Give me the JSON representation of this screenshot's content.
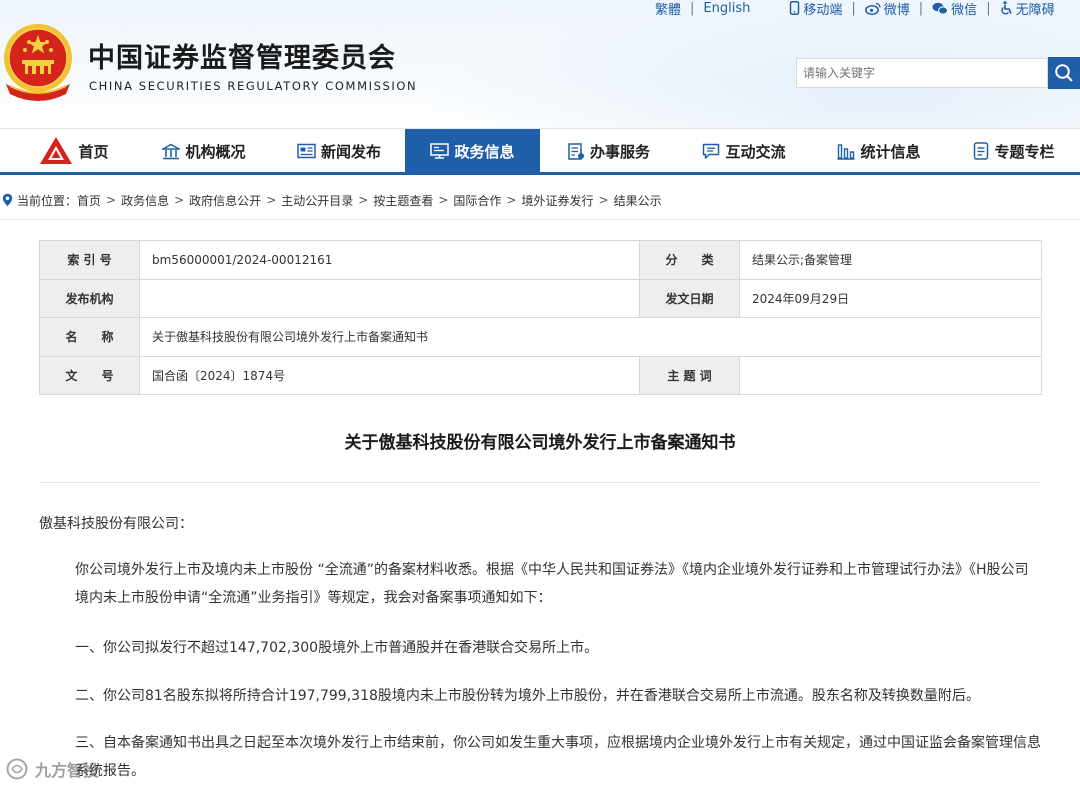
{
  "colors": {
    "brand_blue": "#1f5ea8",
    "emblem_red": "#d4241c",
    "emblem_gold": "#f2c230"
  },
  "top_links": {
    "traditional": "繁體",
    "english": "English",
    "mobile": "移动端",
    "weibo": "微博",
    "wechat": "微信",
    "accessibility": "无障碍"
  },
  "header": {
    "name_cn": "中国证券监督管理委员会",
    "name_en": "CHINA SECURITIES REGULATORY COMMISSION",
    "emblem_icon": "national-emblem-icon"
  },
  "search": {
    "placeholder": "请输入关键字",
    "icon": "search-icon"
  },
  "nav": {
    "items": [
      {
        "label": "首页",
        "icon": "csrc-logo-icon",
        "active": false
      },
      {
        "label": "机构概况",
        "icon": "building-icon",
        "active": false
      },
      {
        "label": "新闻发布",
        "icon": "newspaper-icon",
        "active": false
      },
      {
        "label": "政务信息",
        "icon": "monitor-icon",
        "active": true
      },
      {
        "label": "办事服务",
        "icon": "checklist-icon",
        "active": false
      },
      {
        "label": "互动交流",
        "icon": "chat-icon",
        "active": false
      },
      {
        "label": "统计信息",
        "icon": "bar-chart-icon",
        "active": false
      },
      {
        "label": "专题专栏",
        "icon": "document-icon",
        "active": false
      }
    ]
  },
  "breadcrumb": {
    "prefix": "当前位置：",
    "items": [
      "首页",
      "政务信息",
      "政府信息公开",
      "主动公开目录",
      "按主题查看",
      "国际合作",
      "境外证券发行",
      "结果公示"
    ]
  },
  "info": {
    "index_label": "索 引 号",
    "index_value": "bm56000001/2024-00012161",
    "category_label": "分　　类",
    "category_value": "结果公示;备案管理",
    "publisher_label": "发布机构",
    "publisher_value": "",
    "date_label": "发文日期",
    "date_value": "2024年09月29日",
    "name_label": "名　　称",
    "name_value": "关于傲基科技股份有限公司境外发行上市备案通知书",
    "docno_label": "文　　号",
    "docno_value": "国合函〔2024〕1874号",
    "keywords_label": "主 题 词",
    "keywords_value": ""
  },
  "article": {
    "title": "关于傲基科技股份有限公司境外发行上市备案通知书",
    "salutation": "傲基科技股份有限公司：",
    "para1": "你公司境外发行上市及境内未上市股份 “全流通”的备案材料收悉。根据《中华人民共和国证券法》《境内企业境外发行证券和上市管理试行办法》《H股公司境内未上市股份申请“全流通”业务指引》等规定，我会对备案事项通知如下：",
    "item1": "一、你公司拟发行不超过147,702,300股境外上市普通股并在香港联合交易所上市。",
    "item2": "二、你公司81名股东拟将所持合计197,799,318股境内未上市股份转为境外上市股份，并在香港联合交易所上市流通。股东名称及转换数量附后。",
    "item3": "三、自本备案通知书出具之日起至本次境外发行上市结束前，你公司如发生重大事项，应根据境内企业境外发行上市有关规定，通过中国证监会备案管理信息系统报告。"
  },
  "watermark": "九方智投"
}
